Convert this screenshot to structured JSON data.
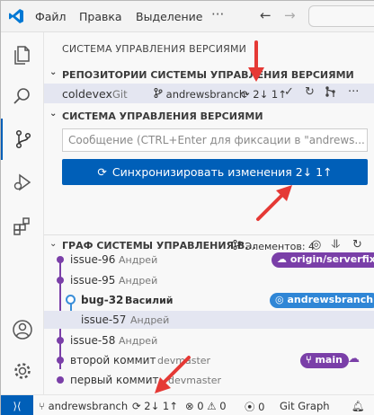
{
  "menu": {
    "file": "Файл",
    "edit": "Правка",
    "selection": "Выделение",
    "more": "···"
  },
  "sidebar": {
    "title": "СИСТЕМА УПРАВЛЕНИЯ ВЕРСИЯМИ"
  },
  "repositories": {
    "header": "РЕПОЗИТОРИИ СИСТЕМЫ УПРАВЛЕНИЯ ВЕРСИЯМИ",
    "repo": {
      "name": "coldevex",
      "kind": "Git",
      "branch": "andrewsbranch",
      "sync": "2↓ 1↑"
    }
  },
  "scm": {
    "header": "СИСТЕМА УПРАВЛЕНИЯ ВЕРСИЯМИ",
    "message_placeholder": "Сообщение (CTRL+Enter для фиксации в \"andrews...",
    "sync_button": "Синхронизировать изменения 2↓ 1↑"
  },
  "graph": {
    "header": "ГРАФ СИСТЕМЫ УПРАВЛЕНИЯ В...",
    "count": "Элементов: 4",
    "commits": [
      {
        "title": "issue-96",
        "author": "Андрей",
        "badge": "origin/serverfix"
      },
      {
        "title": "issue-95",
        "author": "Андрей",
        "badge": ""
      },
      {
        "title": "bug-32",
        "author": "Василий",
        "badge": "andrewsbranch"
      },
      {
        "title": "issue-57",
        "author": "Андрей",
        "badge": ""
      },
      {
        "title": "issue-58",
        "author": "Андрей",
        "badge": ""
      },
      {
        "title": "второй коммит",
        "author": "devmaster",
        "badge": "main"
      },
      {
        "title": "первый коммит",
        "author": "devmaster",
        "badge": ""
      }
    ]
  },
  "statusbar": {
    "branch": "andrewsbranch",
    "sync": "2↓ 1↑",
    "errors": "0",
    "warnings": "0",
    "ports": "0",
    "git_graph": "Git Graph"
  },
  "colors": {
    "accent": "#005fb8",
    "graph_line": "#7a3fa8",
    "badge_blue": "#2f86d6",
    "annotation": "#e53935"
  }
}
